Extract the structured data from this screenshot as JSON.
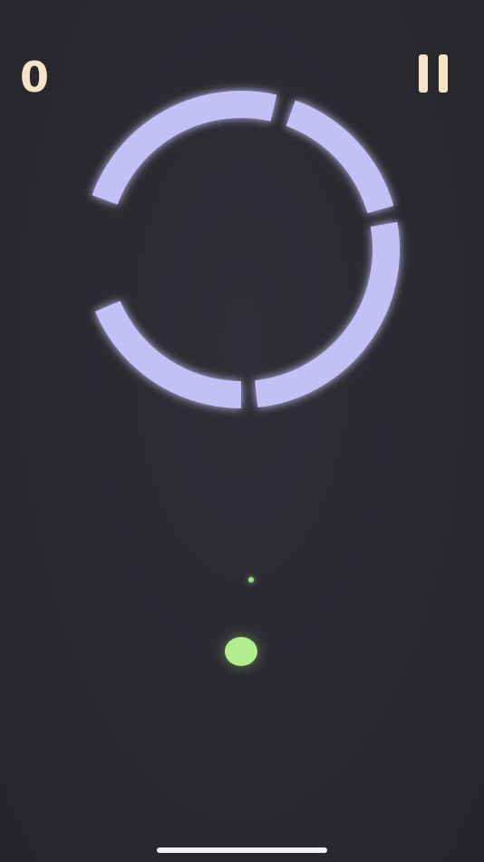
{
  "hud": {
    "score": "0",
    "pause_icon": "pause-icon"
  },
  "colors": {
    "background": "#2b2a31",
    "hud_text": "#f7e4c8",
    "ring": "#c4c0f6",
    "ball": "#b2ee8e",
    "spark": "#9ee07a",
    "home_indicator": "#f2f2f2"
  },
  "ring": {
    "segment_count": 4
  },
  "ball": {
    "state": "idle"
  }
}
